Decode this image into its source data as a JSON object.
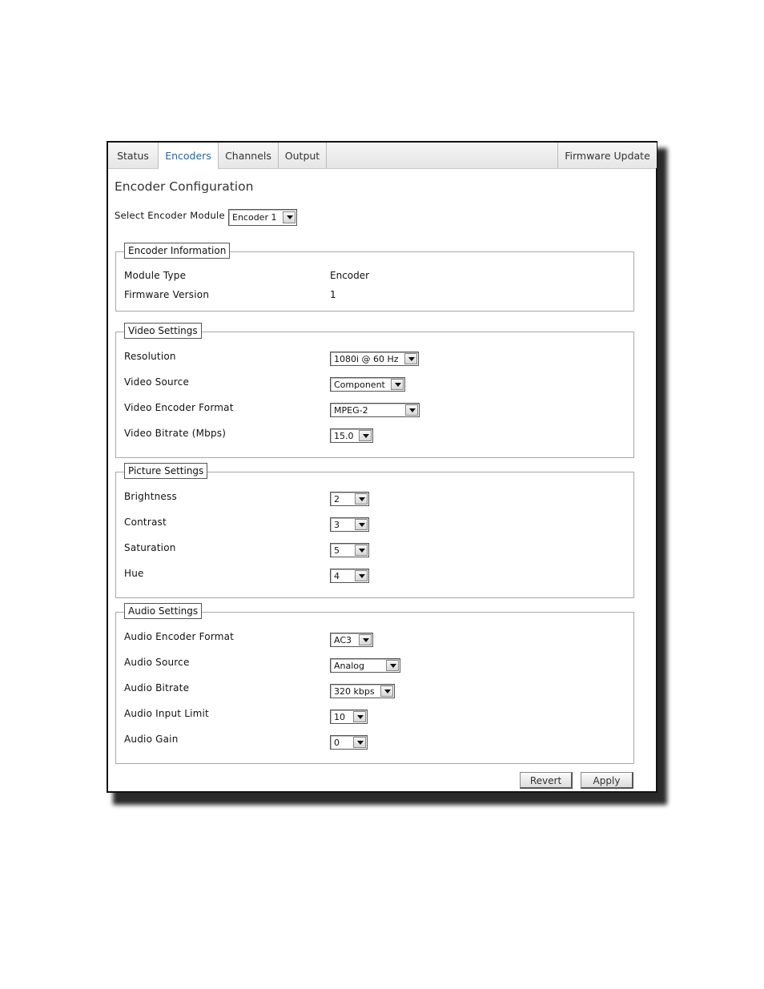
{
  "tabs": {
    "status": "Status",
    "encoders": "Encoders",
    "channels": "Channels",
    "output": "Output",
    "firmware_update": "Firmware Update"
  },
  "page_title": "Encoder Configuration",
  "module_select": {
    "label": "Select Encoder Module",
    "value": "Encoder 1"
  },
  "encoder_info": {
    "legend": "Encoder Information",
    "module_type_label": "Module Type",
    "module_type_value": "Encoder",
    "firmware_version_label": "Firmware Version",
    "firmware_version_value": "1"
  },
  "video": {
    "legend": "Video Settings",
    "resolution_label": "Resolution",
    "resolution_value": "1080i @ 60 Hz",
    "source_label": "Video Source",
    "source_value": "Component",
    "format_label": "Video Encoder Format",
    "format_value": "MPEG-2",
    "bitrate_label": "Video Bitrate (Mbps)",
    "bitrate_value": "15.0"
  },
  "picture": {
    "legend": "Picture Settings",
    "brightness_label": "Brightness",
    "brightness_value": "2",
    "contrast_label": "Contrast",
    "contrast_value": "3",
    "saturation_label": "Saturation",
    "saturation_value": "5",
    "hue_label": "Hue",
    "hue_value": "4"
  },
  "audio": {
    "legend": "Audio Settings",
    "format_label": "Audio Encoder Format",
    "format_value": "AC3",
    "source_label": "Audio Source",
    "source_value": "Analog",
    "bitrate_label": "Audio Bitrate",
    "bitrate_value": "320 kbps",
    "input_limit_label": "Audio Input Limit",
    "input_limit_value": "10",
    "gain_label": "Audio Gain",
    "gain_value": "0"
  },
  "buttons": {
    "revert": "Revert",
    "apply": "Apply"
  }
}
